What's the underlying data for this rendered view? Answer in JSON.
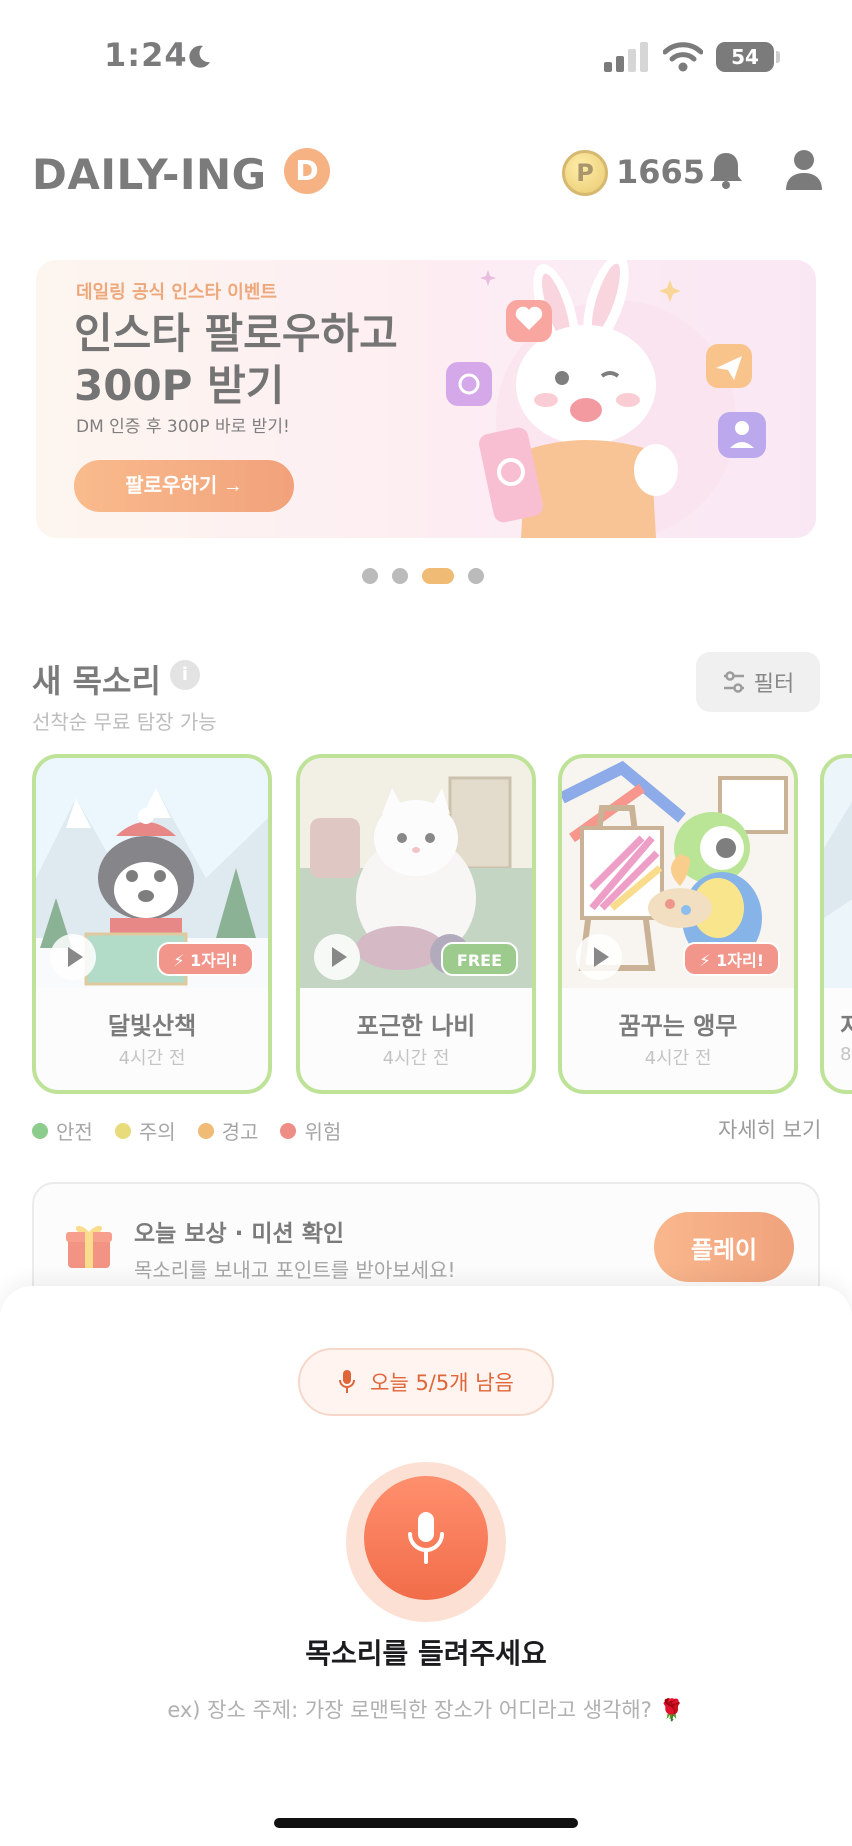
{
  "status_bar": {
    "time": "1:24",
    "battery": "54"
  },
  "header": {
    "logo": "DAILY-ING",
    "logo_badge": "D",
    "coin_symbol": "P",
    "points": "1665"
  },
  "banner": {
    "tag": "데일링 공식 인스타 이벤트",
    "title": "인스타 팔로우하고 300P 받기",
    "subtitle": "DM 인증 후 300P 바로 받기!",
    "cta": "팔로우하기 →"
  },
  "carousel": {
    "count": 4,
    "active_index": 2
  },
  "new_voices": {
    "title": "새 목소리",
    "info": "i",
    "subtitle": "선착순 무료 탐장 가능",
    "filter_label": "필터",
    "cards": [
      {
        "name": "달빛산책",
        "time": "4시간 전",
        "badge": "⚡ 1자리!",
        "badge_type": "hot",
        "image": "husky-hiker"
      },
      {
        "name": "포근한 나비",
        "time": "4시간 전",
        "badge": "FREE",
        "badge_type": "free",
        "image": "knitting-cat"
      },
      {
        "name": "꿈꾸는 앵무",
        "time": "4시간 전",
        "badge": "⚡ 1자리!",
        "badge_type": "hot",
        "image": "painter-parrot"
      },
      {
        "name": "지",
        "time": "8",
        "badge": "",
        "badge_type": "",
        "image": "partial"
      }
    ]
  },
  "legend": {
    "items": [
      {
        "label": "안전",
        "color": "#3aa83a"
      },
      {
        "label": "주의",
        "color": "#d8c21a"
      },
      {
        "label": "경고",
        "color": "#e38a12"
      },
      {
        "label": "위험",
        "color": "#e03b2e"
      }
    ],
    "more": "자세히 보기"
  },
  "mission": {
    "title": "오늘 보상 · 미션 확인",
    "subtitle": "목소리를 보내고 포인트를 받아보세요!",
    "button": "플레이"
  },
  "sheet": {
    "remaining": "오늘 5/5개 남음",
    "prompt_title": "목소리를 들려주세요",
    "prompt_hint": "ex) 장소 주제: 가장 로맨틱한 장소가 어디라고 생각해? 🌹"
  },
  "colors": {
    "accent": "#f26d4a",
    "brand_orange": "#f07b2a",
    "card_border": "#8fcf4f"
  }
}
